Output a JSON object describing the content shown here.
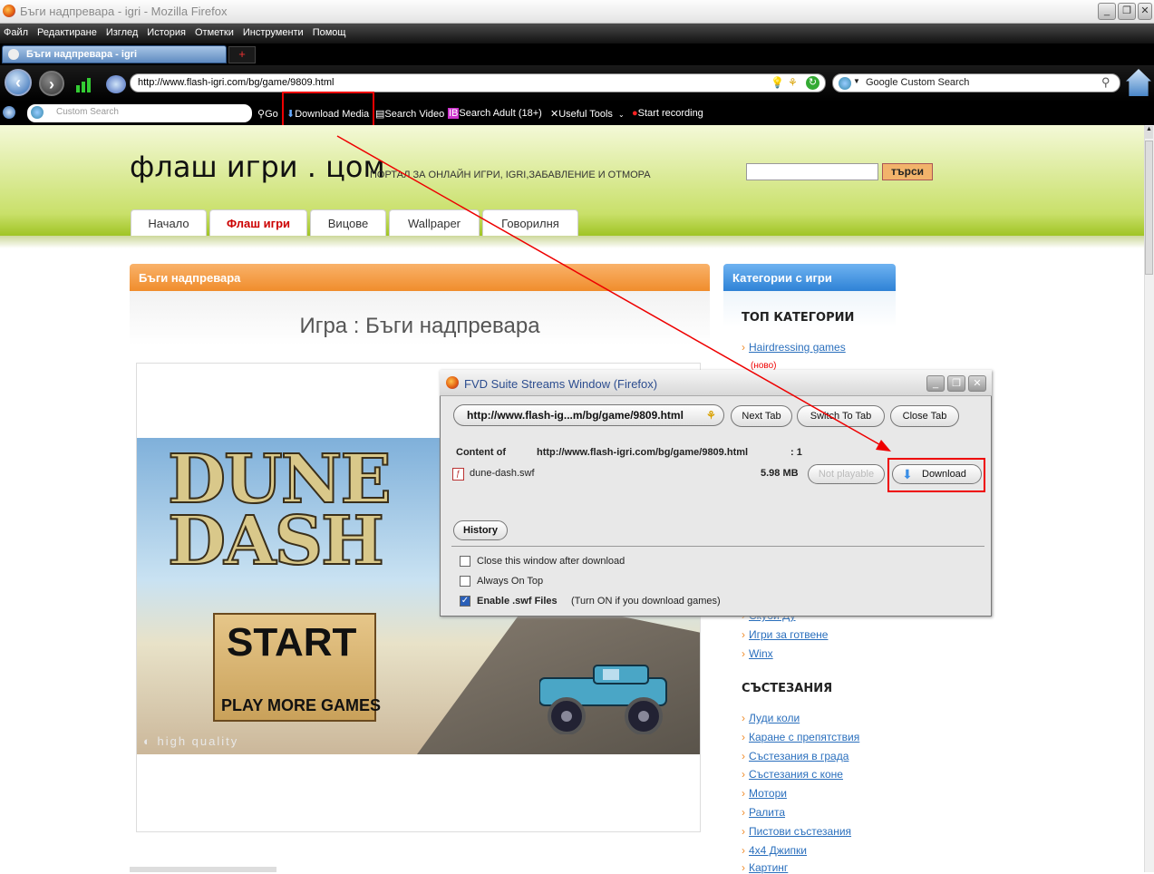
{
  "window": {
    "title": "Бъги надпревара - igri - Mozilla Firefox"
  },
  "menu": [
    "Файл",
    "Редактиране",
    "Изглед",
    "История",
    "Отметки",
    "Инструменти",
    "Помощ"
  ],
  "tab": {
    "label": "Бъги надпревара - igri",
    "new_tab": "+"
  },
  "nav": {
    "url": "http://www.flash-igri.com/bg/game/9809.html",
    "search_placeholder": "Google Custom Search"
  },
  "toolbar2": {
    "google_placeholder": "Custom Search",
    "go": "Go",
    "download_media": "Download Media",
    "search_video": "Search Video",
    "search_adult": "Search Adult (18+)",
    "useful_tools": "Useful Tools",
    "start_recording": "Start recording"
  },
  "site": {
    "logo": "флаш игри . цом",
    "tagline": "ПОРТАЛ ЗА ОНЛАЙН ИГРИ, IGRI,ЗАБАВЛЕНИЕ И ОТМОРА",
    "search_button": "търси",
    "tabs": [
      "Начало",
      "Флаш игри",
      "Вицове",
      "Wallpaper",
      "Говорилня"
    ]
  },
  "game": {
    "panel_title": "Бъги надпревара",
    "heading": "Игра : Бъги надпревара",
    "art_title_1": "DUNE",
    "art_title_2": "DASH",
    "start": "START",
    "play_more": "PLAY MORE GAMES",
    "quality": "high quality"
  },
  "categories": {
    "panel_title": "Категории с игри",
    "top_heading": "ТОП КАТЕГОРИИ",
    "top_first": "Hairdressing games",
    "top_new_badge": "(ново)",
    "partial_link": "Скуби Ду",
    "more_top": [
      "Игри за готвене",
      "Winx"
    ],
    "race_heading": "СЪСТЕЗАНИЯ",
    "race_links": [
      "Луди коли",
      "Каране с препятствия",
      "Състезания в града",
      "Състезания с коне",
      "Мотори",
      "Ралита",
      "Пистови състезания",
      "4x4 Джипки",
      "Картинг"
    ]
  },
  "fvd": {
    "title": "FVD Suite Streams Window (Firefox)",
    "url_dropdown": "http://www.flash-ig...m/bg/game/9809.html",
    "next_tab": "Next Tab",
    "switch_tab": "Switch To Tab",
    "close_tab": "Close Tab",
    "content_of_label": "Content of",
    "content_url": "http://www.flash-igri.com/bg/game/9809.html",
    "content_count": ": 1",
    "file_name": "dune-dash.swf",
    "file_size": "5.98 MB",
    "not_playable": "Not playable",
    "download": "Download",
    "history": "History",
    "opt_close": "Close this window after download",
    "opt_top": "Always On Top",
    "opt_swf": "Enable .swf Files",
    "opt_swf_hint": "(Turn ON if you download games)",
    "opt_close_checked": false,
    "opt_top_checked": false,
    "opt_swf_checked": true
  },
  "colors": {
    "accent_orange": "#f08d2c",
    "accent_blue": "#2e82d6",
    "annotation_red": "#e00000",
    "link": "#2a6fbd"
  }
}
